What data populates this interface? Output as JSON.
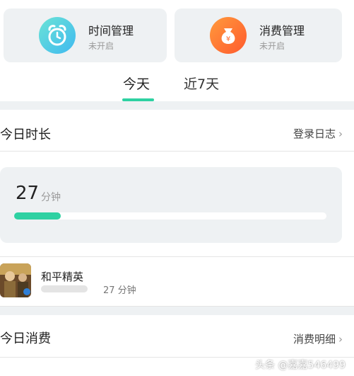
{
  "cards": [
    {
      "title": "时间管理",
      "status": "未开启",
      "icon": "alarm-clock-icon"
    },
    {
      "title": "消费管理",
      "status": "未开启",
      "icon": "money-bag-icon"
    }
  ],
  "tabs": [
    {
      "label": "今天",
      "active": true
    },
    {
      "label": "近7天",
      "active": false
    }
  ],
  "today_duration": {
    "title": "今日时长",
    "link": "登录日志",
    "value": "27",
    "unit": "分钟",
    "progress_fraction": 0.15
  },
  "games": [
    {
      "name": "和平精英",
      "time": "27 分钟"
    }
  ],
  "today_spending": {
    "title": "今日消费",
    "link": "消费明细"
  },
  "watermark": "头条 @嘉嘉546499",
  "colors": {
    "accent": "#2ed1a2",
    "card_bg": "#eef1f3",
    "clock_gradient": [
      "#6be3d6",
      "#3fb9f0"
    ],
    "bag_gradient": [
      "#ff9a3c",
      "#ff5a2e"
    ]
  }
}
